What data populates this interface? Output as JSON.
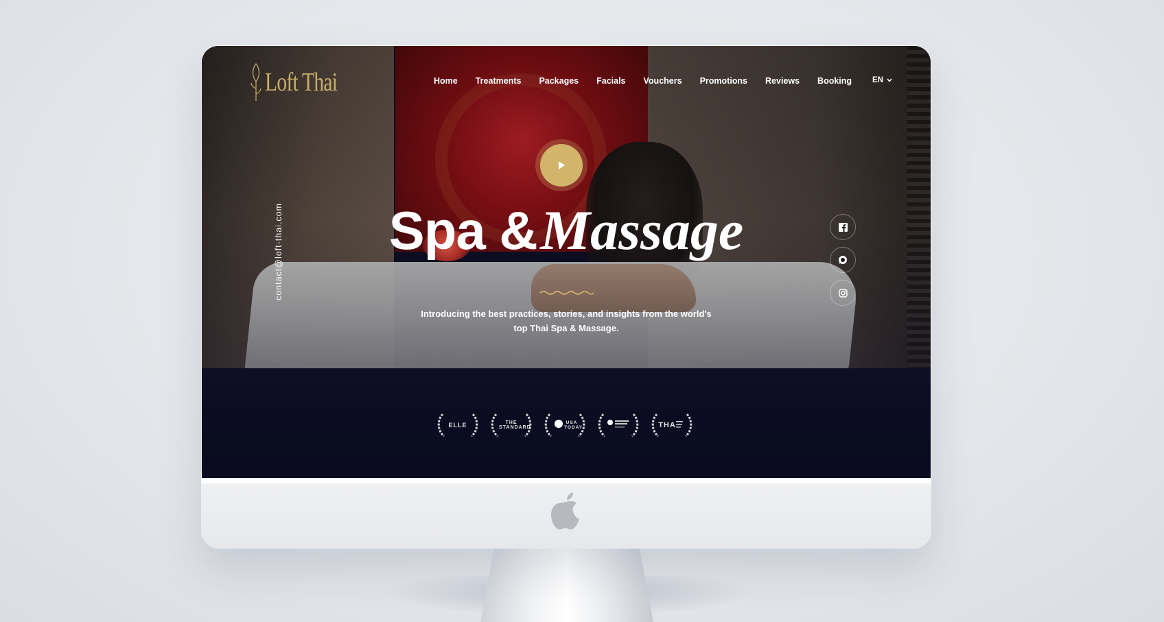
{
  "header": {
    "logo_text": "Loft Thai",
    "nav": [
      "Home",
      "Treatments",
      "Packages",
      "Facials",
      "Vouchers",
      "Promotions",
      "Reviews",
      "Booking"
    ],
    "language": "EN"
  },
  "hero": {
    "title_main": "Spa &",
    "title_accent": "Massage",
    "subtitle": "Introducing the best practices, stories, and insights from the world's top Thai Spa & Massage.",
    "contact_email": "contact@loft-thai.com"
  },
  "social_icons": [
    "facebook-icon",
    "chat-icon",
    "instagram-icon"
  ],
  "awards": [
    "ELLE",
    "THE STANDARD",
    "USA TODAY",
    "",
    "THA"
  ],
  "colors": {
    "accent_gold": "#d2b56b",
    "logo_gold": "#c7ae6a",
    "dark_navy": "#0e0f24",
    "text_white": "#ffffff"
  }
}
